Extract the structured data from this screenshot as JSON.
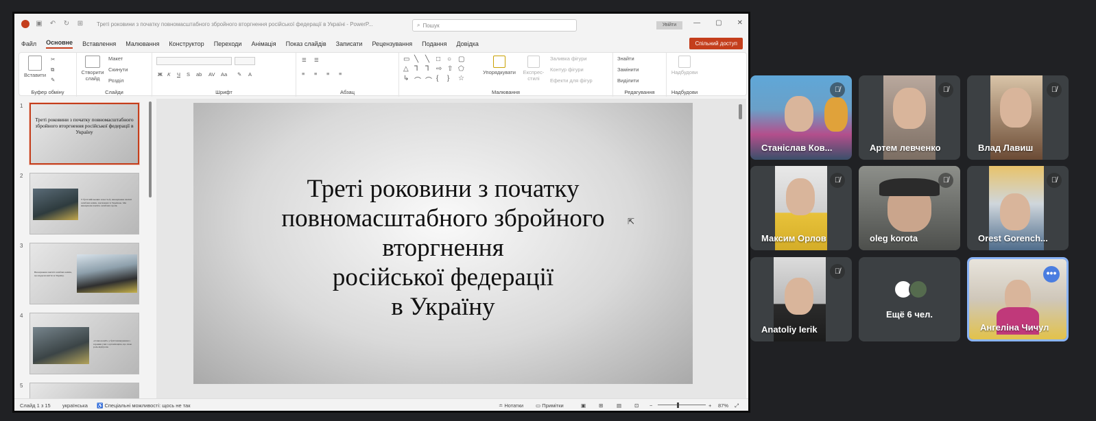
{
  "ppt": {
    "doc_title": "Треті роковини з початку повномасштабного збройного вторгнення російської федерації в Україні  -  PowerP...",
    "search_placeholder": "Пошук",
    "signin": "Увійти",
    "share": "Спільний доступ",
    "tabs": [
      "Файл",
      "Основне",
      "Вставлення",
      "Малювання",
      "Конструктор",
      "Переходи",
      "Анімація",
      "Показ слайдів",
      "Записати",
      "Рецензування",
      "Подання",
      "Довідка"
    ],
    "ribbon": {
      "paste": "Вставити",
      "clipboard_group": "Буфер обміну",
      "new_slide": "Створити слайд",
      "layout": "Макет",
      "reset": "Скинути",
      "section": "Розділ",
      "slides_group": "Слайди",
      "font_group": "Шрифт",
      "paragraph_group": "Абзац",
      "arrange": "Упорядкувати",
      "quick_styles": "Експрес-стилі",
      "shape_fill": "Заливка фігури",
      "shape_outline": "Контур фігури",
      "shape_effects": "Ефекти для фігур",
      "drawing_group": "Малювання",
      "find": "Знайти",
      "replace": "Замінити",
      "select": "Виділити",
      "editing_group": "Редагування",
      "addins": "Надбудови",
      "addins_group": "Надбудови"
    },
    "thumbnails": [
      {
        "num": "1",
        "title": "Треті роковини з початку повномасштабного збройного вторгнення російської федерації в Україну"
      },
      {
        "num": "2",
        "text": "У бухті військових почесть й, вшанування пам'яті загиблих воїнів, пов'язаних із Україною. Ми вшанували пам'ять загиблих героїв."
      },
      {
        "num": "3",
        "text": "Вшанування пам'яті загиблих воїнів, що віддали життя за Україну."
      },
      {
        "num": "4",
        "text": "«Слава нації!» у бухті вшанування з героями учні з організацією, що свою роль відіграли."
      },
      {
        "num": "5"
      }
    ],
    "slide_title_lines": [
      "Треті роковини з початку",
      "повномасштабного збройного",
      "вторгнення",
      "російської федерації",
      "в Україну"
    ],
    "status": {
      "slide_info": "Слайд 1 з 15",
      "language": "українська",
      "accessibility": "Спеціальні можливості: щось не так",
      "notes": "Нотатки",
      "comments": "Примітки",
      "zoom": "87%"
    }
  },
  "meet": {
    "participants": [
      {
        "name": "Станіслав Ковальчук",
        "display": "Станіслав Ков...",
        "muted": true
      },
      {
        "name": "Артем левченко",
        "display": "Артем левченко",
        "muted": true
      },
      {
        "name": "Влад Лавиш",
        "display": "Влад Лавиш",
        "muted": true
      },
      {
        "name": "Максим Орлов",
        "display": "Максим Орлов",
        "muted": true
      },
      {
        "name": "oleg korota",
        "display": "oleg korota",
        "muted": true
      },
      {
        "name": "Orest Gorench",
        "display": "Orest Gorench...",
        "muted": true
      },
      {
        "name": "Anatoliy Ierik",
        "display": "Anatoliy Ierik",
        "muted": true
      }
    ],
    "more_label": "Ещё 6 чел.",
    "self": {
      "name": "Ангеліна Чичул"
    },
    "accent_color": "#8ab4f8"
  }
}
